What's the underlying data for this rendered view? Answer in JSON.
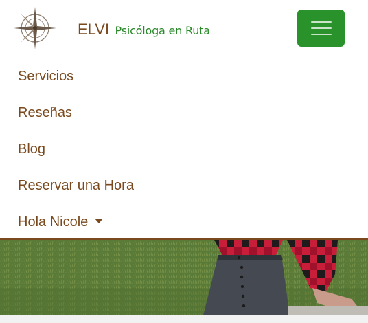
{
  "brand": {
    "name": "ELVI",
    "tagline": "Psicóloga en Ruta",
    "logo_icon": "compass-rose-icon"
  },
  "toggler": {
    "icon": "hamburger-menu-icon",
    "color": "#2a922a"
  },
  "nav": {
    "items": [
      {
        "label": "Servicios"
      },
      {
        "label": "Reseñas"
      },
      {
        "label": "Blog"
      },
      {
        "label": "Reservar una Hora"
      },
      {
        "label": "Hola Nicole",
        "dropdown": true
      }
    ]
  },
  "colors": {
    "brand_brown": "#7a4a1e",
    "brand_green": "#2a8a2a"
  }
}
